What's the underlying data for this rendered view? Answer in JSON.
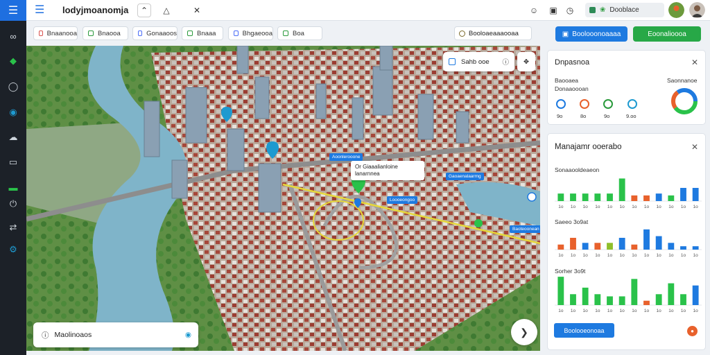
{
  "app": {
    "title": "lodyjmoanomja"
  },
  "topbar": {
    "status_chip": "Dooblace"
  },
  "filters": [
    {
      "label": "Bnaanooa",
      "color": "#d9534f"
    },
    {
      "label": "Bnaooa",
      "color": "#2a9a3c"
    },
    {
      "label": "Gonaaoos",
      "color": "#4a6cf7"
    },
    {
      "label": "Bnaaa",
      "color": "#2a9a3c"
    },
    {
      "label": "Bhgaeooa",
      "color": "#4a6cf7"
    },
    {
      "label": "Boa",
      "color": "#2a9a3c"
    }
  ],
  "filter_right": "Booloaeaaaooaa",
  "actions": {
    "primary": "Boolooonoaaaa",
    "secondary": "Eoonalioooa"
  },
  "map": {
    "search_tool": "Sahb ooe",
    "search_bottom": "Maolinoaos",
    "callout_line1": "Or Giaaalianloine",
    "callout_line2": "lanarnnea",
    "tags": [
      "Aoonlerooone",
      "Gaoaenalaarmg",
      "Loooeongoo",
      "Baoteoonean"
    ]
  },
  "panel_top": {
    "title": "Dnpasnoa",
    "sub1": "Baooaea",
    "sub2": "Donaaoooan",
    "right_label": "Saonnanoe",
    "metrics": [
      {
        "value": "9o",
        "color": "#1e7ae0"
      },
      {
        "value": "8o",
        "color": "#e8612c"
      },
      {
        "value": "9o",
        "color": "#2a9a3c"
      },
      {
        "value": "9.oo",
        "color": "#1e9ad0"
      }
    ]
  },
  "panel_bottom": {
    "title": "Manajamr ooerabo",
    "view_button": "Boolooeonoaa",
    "charts": [
      {
        "title": "Sonaaooldeaeon",
        "ticks": [
          "1o",
          "1o",
          "1o",
          "1o",
          "1o",
          "1o",
          "1o",
          "1o",
          "1o",
          "1o",
          "1o",
          "1o"
        ],
        "colors": [
          "#2ac24a",
          "#2ac24a",
          "#2ac24a",
          "#2ac24a",
          "#2ac24a",
          "#2ac24a",
          "#e8612c",
          "#e8612c",
          "#1e7ae0",
          "#2ac24a",
          "#1e7ae0",
          "#1e7ae0"
        ]
      },
      {
        "title": "Saeeo 3o9at",
        "ticks": [
          "1o",
          "1o",
          "1o",
          "1o",
          "1o",
          "1o",
          "1o",
          "1o",
          "1o",
          "1o",
          "1o",
          "1o"
        ],
        "colors": [
          "#e8612c",
          "#e8612c",
          "#1e7ae0",
          "#e8612c",
          "#8fbf2a",
          "#1e7ae0",
          "#e8612c",
          "#1e7ae0",
          "#1e7ae0",
          "#1e7ae0",
          "#1e7ae0",
          "#1e7ae0"
        ]
      },
      {
        "title": "Sorher 3o9t",
        "ticks": [
          "1o",
          "1o",
          "1o",
          "1o",
          "1o",
          "1o",
          "1o",
          "1o",
          "1o",
          "1o",
          "1o",
          "1o"
        ],
        "colors": [
          "#2ac24a",
          "#2ac24a",
          "#2ac24a",
          "#2ac24a",
          "#2ac24a",
          "#2ac24a",
          "#2ac24a",
          "#e8612c",
          "#2ac24a",
          "#2ac24a",
          "#2ac24a",
          "#1e7ae0"
        ]
      }
    ]
  },
  "chart_data": [
    {
      "type": "bar",
      "title": "Sonaaooldeaeon",
      "categories": [
        "1o",
        "1o",
        "1o",
        "1o",
        "1o",
        "1o",
        "1o",
        "1o",
        "1o",
        "1o",
        "1o",
        "1o"
      ],
      "values": [
        4,
        4,
        4,
        4,
        4,
        12,
        3,
        3,
        4,
        3,
        7,
        7
      ],
      "ylim": [
        0,
        14
      ]
    },
    {
      "type": "bar",
      "title": "Saeeo 3o9at",
      "categories": [
        "1o",
        "1o",
        "1o",
        "1o",
        "1o",
        "1o",
        "1o",
        "1o",
        "1o",
        "1o",
        "1o",
        "1o"
      ],
      "values": [
        3,
        7,
        4,
        4,
        4,
        7,
        3,
        12,
        8,
        4,
        2,
        2
      ],
      "ylim": [
        0,
        14
      ]
    },
    {
      "type": "bar",
      "title": "Sorher 3o9t",
      "categories": [
        "1o",
        "1o",
        "1o",
        "1o",
        "1o",
        "1o",
        "1o",
        "1o",
        "1o",
        "1o",
        "1o",
        "1o"
      ],
      "values": [
        13,
        5,
        8,
        5,
        4,
        4,
        12,
        2,
        5,
        10,
        5,
        9
      ],
      "ylim": [
        0,
        14
      ]
    }
  ]
}
